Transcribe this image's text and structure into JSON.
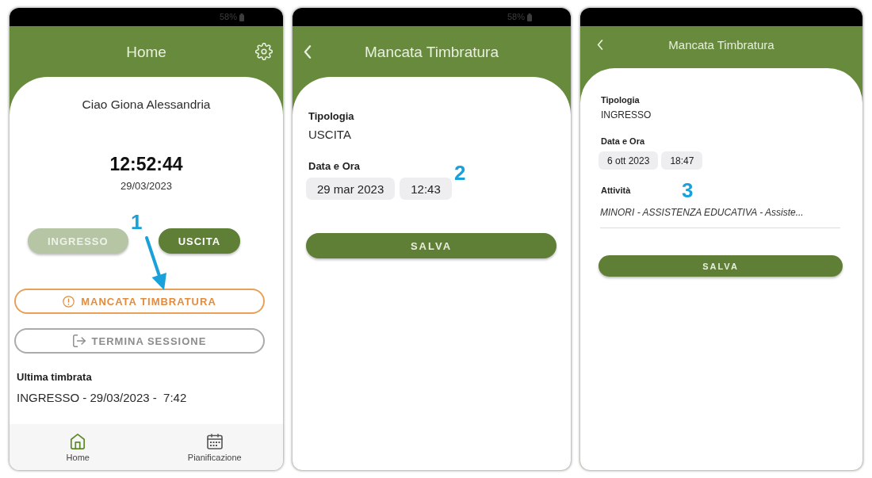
{
  "screens": [
    {
      "kind": "home",
      "status_bar": {
        "battery": "58%"
      },
      "header": {
        "title": "Home",
        "settings": true
      },
      "greeting": "Ciao Giona Alessandria",
      "clock": {
        "time": "12:52:44",
        "date": "29/03/2023"
      },
      "punch_buttons": [
        {
          "label": "INGRESSO",
          "disabled": true
        },
        {
          "label": "USCITA",
          "disabled": false
        }
      ],
      "actions": [
        {
          "kind": "warning",
          "label": "MANCATA TIMBRATURA"
        },
        {
          "kind": "logout",
          "label": "TERMINA SESSIONE"
        }
      ],
      "last_punch": {
        "label": "Ultima timbrata",
        "value": "INGRESSO - 29/03/2023 -  7:42"
      },
      "bottom_nav": [
        {
          "label": "Home",
          "selected": true
        },
        {
          "label": "Pianificazione",
          "selected": false
        }
      ],
      "annotation": {
        "label": "1",
        "arrow": true
      }
    },
    {
      "kind": "form",
      "status_bar": {
        "battery": "58%"
      },
      "header": {
        "title": "Mancata Timbratura",
        "back": true
      },
      "fields": [
        {
          "kind": "text",
          "label": "Tipologia",
          "value": "USCITA"
        },
        {
          "kind": "datetime",
          "label": "Data e Ora",
          "date": "29 mar 2023",
          "time": "12:43"
        }
      ],
      "submit": "SALVA",
      "annotation": {
        "label": "2"
      }
    },
    {
      "kind": "form",
      "header": {
        "title": "Mancata Timbratura",
        "back": true
      },
      "fields": [
        {
          "kind": "text",
          "label": "Tipologia",
          "value": "INGRESSO"
        },
        {
          "kind": "datetime",
          "label": "Data e Ora",
          "date": "6 ott 2023",
          "time": "18:47"
        },
        {
          "kind": "select",
          "label": "Attività",
          "value": "MINORI - ASSISTENZA EDUCATIVA - Assiste..."
        }
      ],
      "submit": "SALVA",
      "annotation": {
        "label": "3"
      }
    }
  ]
}
